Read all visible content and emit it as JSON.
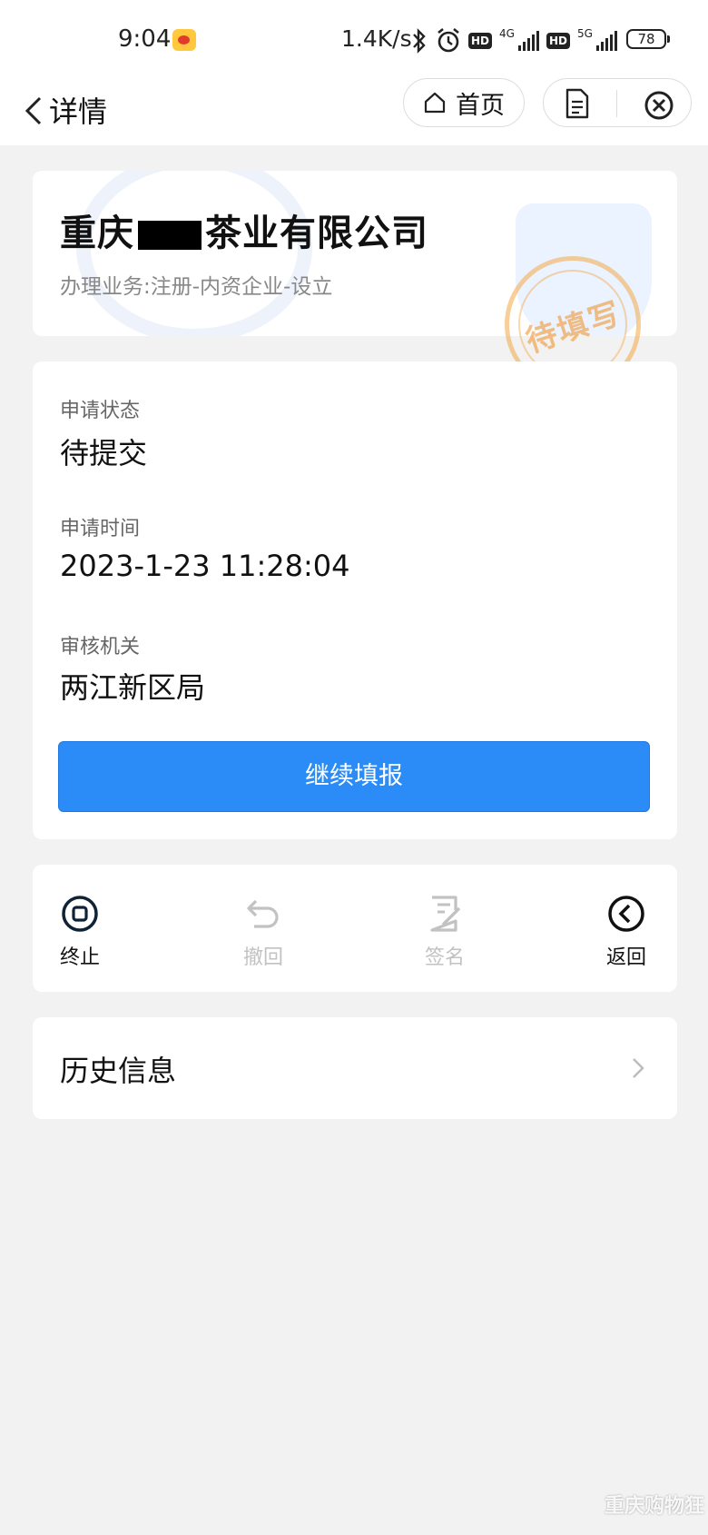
{
  "status_bar": {
    "time": "9:04",
    "net_speed": "1.4K/s",
    "sim1_label": "4G",
    "sim2_label": "5G",
    "hd_label": "HD",
    "battery": "78"
  },
  "nav": {
    "title": "详情",
    "home_label": "首页"
  },
  "company_card": {
    "name_prefix": "重庆",
    "name_suffix": "茶业有限公司",
    "business": "办理业务:注册-内资企业-设立",
    "stamp_text": "待填写"
  },
  "info_card": {
    "fields": [
      {
        "label": "申请状态",
        "value": "待提交"
      },
      {
        "label": "申请时间",
        "value": "2023-1-23 11:28:04"
      },
      {
        "label": "审核机关",
        "value": "两江新区局"
      }
    ],
    "primary_button": "继续填报"
  },
  "actions": [
    {
      "label": "终止",
      "enabled": true,
      "icon": "stop-circle-icon"
    },
    {
      "label": "撤回",
      "enabled": false,
      "icon": "undo-icon"
    },
    {
      "label": "签名",
      "enabled": false,
      "icon": "sign-doc-icon"
    },
    {
      "label": "返回",
      "enabled": true,
      "icon": "back-circle-icon"
    }
  ],
  "history": {
    "label": "历史信息"
  },
  "colors": {
    "primary": "#2b8cf7",
    "background": "#f2f2f2",
    "disabled": "#c2c2c2",
    "stamp": "#f4a846"
  },
  "watermark": "重庆购物狂"
}
